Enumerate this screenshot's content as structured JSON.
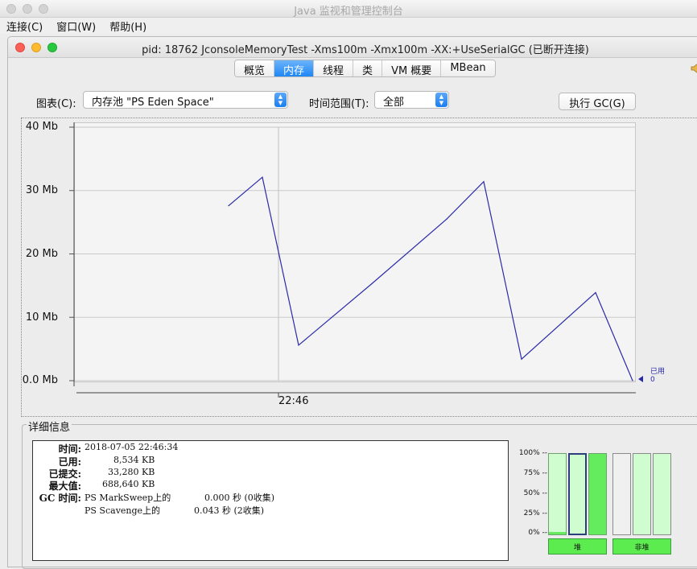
{
  "outer_window": {
    "title": "Java 监视和管理控制台"
  },
  "menubar": {
    "items": [
      "连接(C)",
      "窗口(W)",
      "帮助(H)"
    ]
  },
  "frame": {
    "title": "pid: 18762 JconsoleMemoryTest -Xms100m -Xmx100m -XX:+UseSerialGC (已断开连接)"
  },
  "tabs": [
    {
      "label": "概览",
      "active": false
    },
    {
      "label": "内存",
      "active": true
    },
    {
      "label": "线程",
      "active": false
    },
    {
      "label": "类",
      "active": false
    },
    {
      "label": "VM 概要",
      "active": false
    },
    {
      "label": "MBean",
      "active": false
    }
  ],
  "controls": {
    "chart_label": "图表(C):",
    "chart_value": "内存池 \"PS Eden Space\"",
    "range_label": "时间范围(T):",
    "range_value": "全部",
    "gc_button": "执行 GC(G)"
  },
  "chart_data": {
    "type": "line",
    "y_ticks": [
      "40 Mb",
      "30 Mb",
      "20 Mb",
      "10 Mb",
      "0.0 Mb"
    ],
    "ylim": [
      0,
      40
    ],
    "x_tick": "22:46",
    "series": [
      {
        "name": "已用",
        "color": "#2b2ba8",
        "points": [
          [
            0,
            27.6
          ],
          [
            1,
            32.1
          ],
          [
            2,
            5.6
          ],
          [
            3,
            15.3
          ],
          [
            4,
            25.5
          ],
          [
            5,
            31.4
          ],
          [
            6,
            3.4
          ],
          [
            7,
            13.9
          ],
          [
            8,
            0
          ]
        ]
      }
    ],
    "legend": {
      "label": "已用",
      "value": "0"
    },
    "grid": true
  },
  "details": {
    "title": "详细信息",
    "time_label": "时间:",
    "time_value": "2018-07-05 22:46:34",
    "used_label": "已用:",
    "used_value": "8,534 KB",
    "committed_label": "已提交:",
    "committed_value": "33,280 KB",
    "max_label": "最大值:",
    "max_value": "688,640 KB",
    "gc_label": "GC 时间:",
    "gc_rows": [
      {
        "name": "PS MarkSweep上的",
        "time": "0.000 秒 (0收集)"
      },
      {
        "name": "PS Scavenge上的",
        "time": "0.043 秒 (2收集)"
      }
    ]
  },
  "usage_bars": {
    "pct_labels": [
      "100% --",
      "75% --",
      "50% --",
      "25% --",
      "0% --"
    ],
    "heap_label": "堆",
    "nonheap_label": "非堆",
    "heap_fill": [
      0.03,
      0.0,
      1.0
    ],
    "nonheap_fill": [
      0.0,
      1.0,
      1.0
    ]
  }
}
